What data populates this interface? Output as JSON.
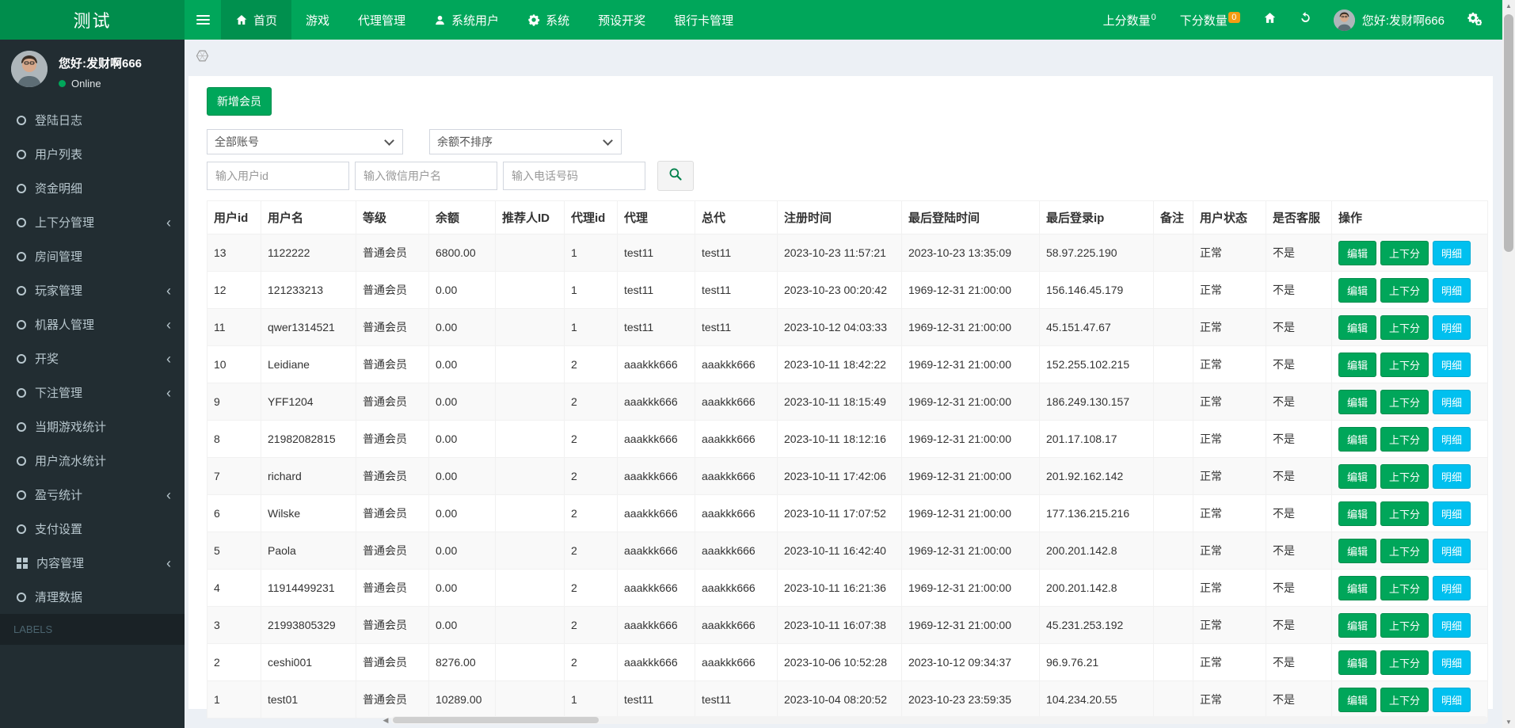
{
  "navbar": {
    "logo": "测试",
    "items": [
      {
        "label": "首页",
        "icon": "home-icon",
        "active": true
      },
      {
        "label": "游戏",
        "icon": "none",
        "active": false
      },
      {
        "label": "代理管理",
        "icon": "none",
        "active": false
      },
      {
        "label": "系统用户",
        "icon": "user-icon",
        "active": false
      },
      {
        "label": "系统",
        "icon": "gear-icon",
        "active": false
      },
      {
        "label": "预设开奖",
        "icon": "none",
        "active": false
      },
      {
        "label": "银行卡管理",
        "icon": "none",
        "active": false
      }
    ],
    "right": {
      "up_label": "上分数量",
      "up_badge": "0",
      "down_label": "下分数量",
      "down_badge": "0",
      "greeting": "您好:发财啊666",
      "icons": [
        "home-icon",
        "refresh-icon",
        "avatar",
        "cogs-icon"
      ]
    }
  },
  "sidebar": {
    "greeting": "您好:发财啊666",
    "status": "Online",
    "items": [
      {
        "label": "登陆日志",
        "icon": "circle-icon",
        "has_children": false
      },
      {
        "label": "用户列表",
        "icon": "circle-icon",
        "has_children": false
      },
      {
        "label": "资金明细",
        "icon": "circle-icon",
        "has_children": false
      },
      {
        "label": "上下分管理",
        "icon": "circle-icon",
        "has_children": true
      },
      {
        "label": "房间管理",
        "icon": "circle-icon",
        "has_children": false
      },
      {
        "label": "玩家管理",
        "icon": "circle-icon",
        "has_children": true
      },
      {
        "label": "机器人管理",
        "icon": "circle-icon",
        "has_children": true
      },
      {
        "label": "开奖",
        "icon": "circle-icon",
        "has_children": true
      },
      {
        "label": "下注管理",
        "icon": "circle-icon",
        "has_children": true
      },
      {
        "label": "当期游戏统计",
        "icon": "circle-icon",
        "has_children": false
      },
      {
        "label": "用户流水统计",
        "icon": "circle-icon",
        "has_children": false
      },
      {
        "label": "盈亏统计",
        "icon": "circle-icon",
        "has_children": true
      },
      {
        "label": "支付设置",
        "icon": "circle-icon",
        "has_children": false
      },
      {
        "label": "内容管理",
        "icon": "grid-icon",
        "has_children": true
      },
      {
        "label": "清理数据",
        "icon": "circle-icon",
        "has_children": false
      }
    ],
    "labels_header": "LABELS"
  },
  "toolbar": {
    "add_member": "新增会员",
    "select_account": "全部账号",
    "select_sort": "余额不排序",
    "ph_userid": "输入用户id",
    "ph_wechat": "输入微信用户名",
    "ph_phone": "输入电话号码",
    "search_icon": "search-icon"
  },
  "table": {
    "headers": [
      "用户id",
      "用户名",
      "等级",
      "余额",
      "推荐人ID",
      "代理id",
      "代理",
      "总代",
      "注册时间",
      "最后登陆时间",
      "最后登录ip",
      "备注",
      "用户状态",
      "是否客服",
      "操作"
    ],
    "actions": [
      {
        "label": "编辑",
        "style": "btn-success",
        "name": "edit-button"
      },
      {
        "label": "上下分",
        "style": "btn-success",
        "name": "updown-button"
      },
      {
        "label": "明细",
        "style": "btn-info",
        "name": "detail-button"
      }
    ],
    "rows": [
      {
        "id": "13",
        "name": "1122222",
        "level": "普通会员",
        "balance": "6800.00",
        "referrer": "",
        "agent_id": "1",
        "agent": "test11",
        "top_agent": "test11",
        "reg_time": "2023-10-23 11:57:21",
        "last_login": "2023-10-23 13:35:09",
        "last_ip": "58.97.225.190",
        "remark": "",
        "status": "正常",
        "is_cs": "不是"
      },
      {
        "id": "12",
        "name": "121233213",
        "level": "普通会员",
        "balance": "0.00",
        "referrer": "",
        "agent_id": "1",
        "agent": "test11",
        "top_agent": "test11",
        "reg_time": "2023-10-23 00:20:42",
        "last_login": "1969-12-31 21:00:00",
        "last_ip": "156.146.45.179",
        "remark": "",
        "status": "正常",
        "is_cs": "不是"
      },
      {
        "id": "11",
        "name": "qwer1314521",
        "level": "普通会员",
        "balance": "0.00",
        "referrer": "",
        "agent_id": "1",
        "agent": "test11",
        "top_agent": "test11",
        "reg_time": "2023-10-12 04:03:33",
        "last_login": "1969-12-31 21:00:00",
        "last_ip": "45.151.47.67",
        "remark": "",
        "status": "正常",
        "is_cs": "不是"
      },
      {
        "id": "10",
        "name": "Leidiane",
        "level": "普通会员",
        "balance": "0.00",
        "referrer": "",
        "agent_id": "2",
        "agent": "aaakkk666",
        "top_agent": "aaakkk666",
        "reg_time": "2023-10-11 18:42:22",
        "last_login": "1969-12-31 21:00:00",
        "last_ip": "152.255.102.215",
        "remark": "",
        "status": "正常",
        "is_cs": "不是"
      },
      {
        "id": "9",
        "name": "YFF1204",
        "level": "普通会员",
        "balance": "0.00",
        "referrer": "",
        "agent_id": "2",
        "agent": "aaakkk666",
        "top_agent": "aaakkk666",
        "reg_time": "2023-10-11 18:15:49",
        "last_login": "1969-12-31 21:00:00",
        "last_ip": "186.249.130.157",
        "remark": "",
        "status": "正常",
        "is_cs": "不是"
      },
      {
        "id": "8",
        "name": "21982082815",
        "level": "普通会员",
        "balance": "0.00",
        "referrer": "",
        "agent_id": "2",
        "agent": "aaakkk666",
        "top_agent": "aaakkk666",
        "reg_time": "2023-10-11 18:12:16",
        "last_login": "1969-12-31 21:00:00",
        "last_ip": "201.17.108.17",
        "remark": "",
        "status": "正常",
        "is_cs": "不是"
      },
      {
        "id": "7",
        "name": "richard",
        "level": "普通会员",
        "balance": "0.00",
        "referrer": "",
        "agent_id": "2",
        "agent": "aaakkk666",
        "top_agent": "aaakkk666",
        "reg_time": "2023-10-11 17:42:06",
        "last_login": "1969-12-31 21:00:00",
        "last_ip": "201.92.162.142",
        "remark": "",
        "status": "正常",
        "is_cs": "不是"
      },
      {
        "id": "6",
        "name": "Wilske",
        "level": "普通会员",
        "balance": "0.00",
        "referrer": "",
        "agent_id": "2",
        "agent": "aaakkk666",
        "top_agent": "aaakkk666",
        "reg_time": "2023-10-11 17:07:52",
        "last_login": "1969-12-31 21:00:00",
        "last_ip": "177.136.215.216",
        "remark": "",
        "status": "正常",
        "is_cs": "不是"
      },
      {
        "id": "5",
        "name": "Paola",
        "level": "普通会员",
        "balance": "0.00",
        "referrer": "",
        "agent_id": "2",
        "agent": "aaakkk666",
        "top_agent": "aaakkk666",
        "reg_time": "2023-10-11 16:42:40",
        "last_login": "1969-12-31 21:00:00",
        "last_ip": "200.201.142.8",
        "remark": "",
        "status": "正常",
        "is_cs": "不是"
      },
      {
        "id": "4",
        "name": "11914499231",
        "level": "普通会员",
        "balance": "0.00",
        "referrer": "",
        "agent_id": "2",
        "agent": "aaakkk666",
        "top_agent": "aaakkk666",
        "reg_time": "2023-10-11 16:21:36",
        "last_login": "1969-12-31 21:00:00",
        "last_ip": "200.201.142.8",
        "remark": "",
        "status": "正常",
        "is_cs": "不是"
      },
      {
        "id": "3",
        "name": "21993805329",
        "level": "普通会员",
        "balance": "0.00",
        "referrer": "",
        "agent_id": "2",
        "agent": "aaakkk666",
        "top_agent": "aaakkk666",
        "reg_time": "2023-10-11 16:07:38",
        "last_login": "1969-12-31 21:00:00",
        "last_ip": "45.231.253.192",
        "remark": "",
        "status": "正常",
        "is_cs": "不是"
      },
      {
        "id": "2",
        "name": "ceshi001",
        "level": "普通会员",
        "balance": "8276.00",
        "referrer": "",
        "agent_id": "2",
        "agent": "aaakkk666",
        "top_agent": "aaakkk666",
        "reg_time": "2023-10-06 10:52:28",
        "last_login": "2023-10-12 09:34:37",
        "last_ip": "96.9.76.21",
        "remark": "",
        "status": "正常",
        "is_cs": "不是"
      },
      {
        "id": "1",
        "name": "test01",
        "level": "普通会员",
        "balance": "10289.00",
        "referrer": "",
        "agent_id": "1",
        "agent": "test11",
        "top_agent": "test11",
        "reg_time": "2023-10-04 08:20:52",
        "last_login": "2023-10-23 23:59:35",
        "last_ip": "104.234.20.55",
        "remark": "",
        "status": "正常",
        "is_cs": "不是"
      }
    ]
  },
  "colors": {
    "primary_green": "#00a65a",
    "logo_green": "#008d4c",
    "info_blue": "#00c0ef",
    "badge_orange": "#f39c12",
    "sidebar_bg": "#222d32"
  }
}
